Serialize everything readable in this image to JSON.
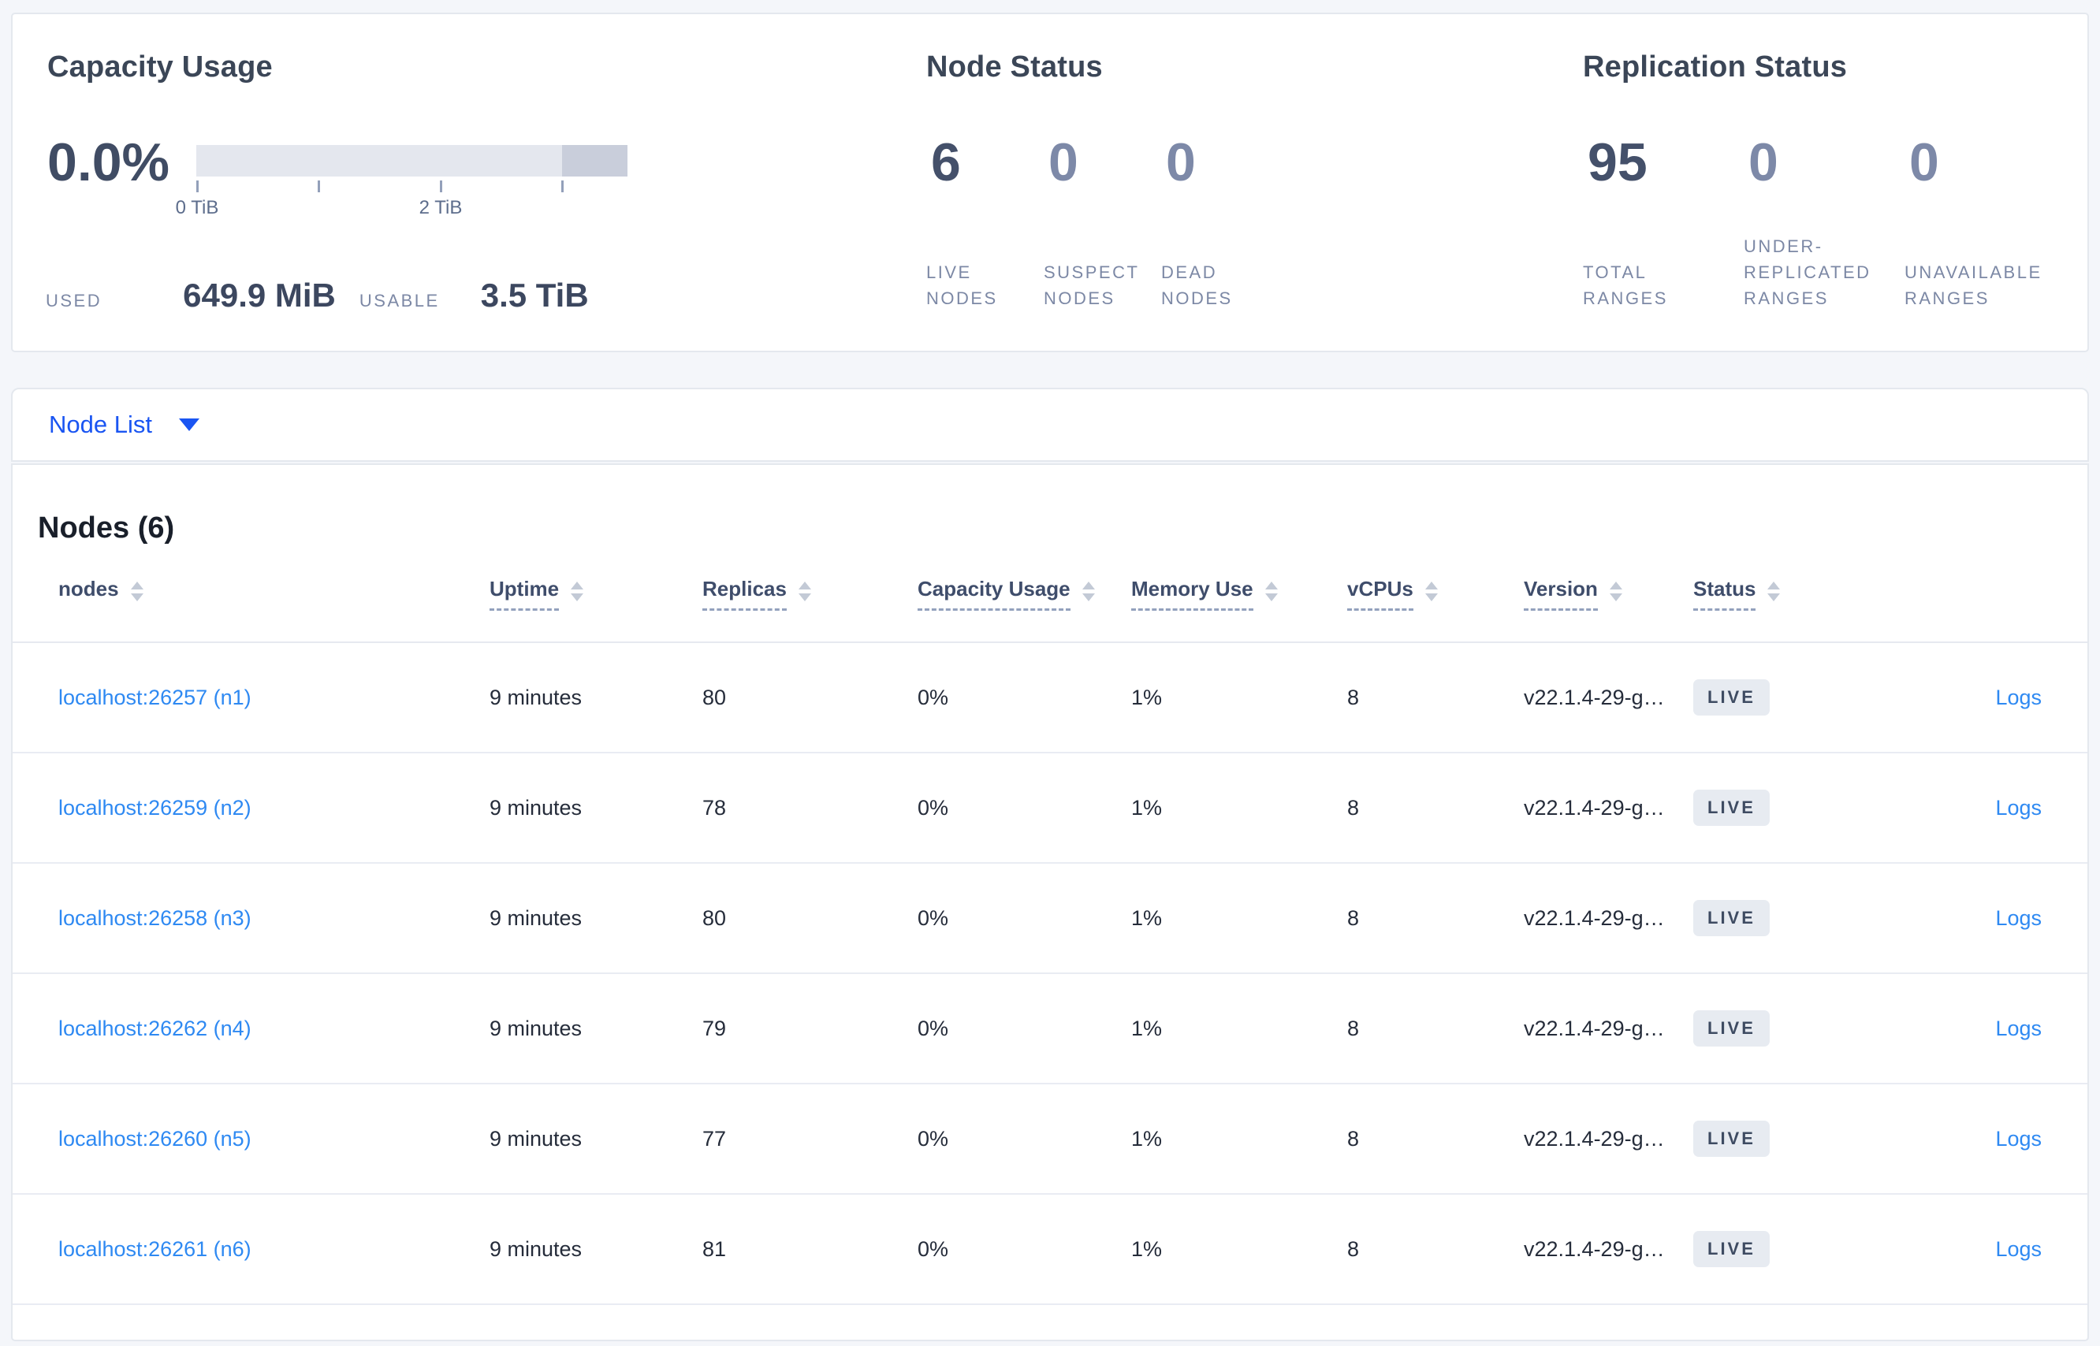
{
  "summary": {
    "capacity": {
      "title": "Capacity Usage",
      "percent": "0.0%",
      "axis_ticks": [
        "0 TiB",
        "2 TiB"
      ],
      "used_label": "USED",
      "used_value": "649.9 MiB",
      "usable_label": "USABLE",
      "usable_value": "3.5 TiB"
    },
    "node_status": {
      "title": "Node Status",
      "stats": [
        {
          "value": "6",
          "label": "LIVE NODES"
        },
        {
          "value": "0",
          "label": "SUSPECT NODES"
        },
        {
          "value": "0",
          "label": "DEAD NODES"
        }
      ]
    },
    "replication_status": {
      "title": "Replication Status",
      "stats": [
        {
          "value": "95",
          "label": "TOTAL RANGES"
        },
        {
          "value": "0",
          "label": "UNDER-REPLICATED RANGES"
        },
        {
          "value": "0",
          "label": "UNAVAILABLE RANGES"
        }
      ]
    }
  },
  "view_selector": {
    "label": "Node List"
  },
  "table": {
    "title": "Nodes (6)",
    "columns": [
      {
        "label": "nodes",
        "underline": false
      },
      {
        "label": "Uptime",
        "underline": true
      },
      {
        "label": "Replicas",
        "underline": true
      },
      {
        "label": "Capacity Usage",
        "underline": true
      },
      {
        "label": "Memory Use",
        "underline": true
      },
      {
        "label": "vCPUs",
        "underline": true
      },
      {
        "label": "Version",
        "underline": true
      },
      {
        "label": "Status",
        "underline": true
      }
    ],
    "rows": [
      {
        "address": "localhost:26257 (n1)",
        "uptime": "9 minutes",
        "replicas": "80",
        "capacity": "0%",
        "memory": "1%",
        "vcpus": "8",
        "version": "v22.1.4-29-g…",
        "status": "LIVE",
        "logs": "Logs"
      },
      {
        "address": "localhost:26259 (n2)",
        "uptime": "9 minutes",
        "replicas": "78",
        "capacity": "0%",
        "memory": "1%",
        "vcpus": "8",
        "version": "v22.1.4-29-g…",
        "status": "LIVE",
        "logs": "Logs"
      },
      {
        "address": "localhost:26258 (n3)",
        "uptime": "9 minutes",
        "replicas": "80",
        "capacity": "0%",
        "memory": "1%",
        "vcpus": "8",
        "version": "v22.1.4-29-g…",
        "status": "LIVE",
        "logs": "Logs"
      },
      {
        "address": "localhost:26262 (n4)",
        "uptime": "9 minutes",
        "replicas": "79",
        "capacity": "0%",
        "memory": "1%",
        "vcpus": "8",
        "version": "v22.1.4-29-g…",
        "status": "LIVE",
        "logs": "Logs"
      },
      {
        "address": "localhost:26260 (n5)",
        "uptime": "9 minutes",
        "replicas": "77",
        "capacity": "0%",
        "memory": "1%",
        "vcpus": "8",
        "version": "v22.1.4-29-g…",
        "status": "LIVE",
        "logs": "Logs"
      },
      {
        "address": "localhost:26261 (n6)",
        "uptime": "9 minutes",
        "replicas": "81",
        "capacity": "0%",
        "memory": "1%",
        "vcpus": "8",
        "version": "v22.1.4-29-g…",
        "status": "LIVE",
        "logs": "Logs"
      }
    ]
  },
  "icons": {
    "node_list_caret": "caret-down",
    "column_sort": "sort-arrows-up-down"
  },
  "colors": {
    "page_bg": "#f4f6fa",
    "card_border": "#e4e8ee",
    "heading_dark": "#3b4657",
    "stat_dark": "#44506a",
    "stat_light": "#7d89a8",
    "label_gray": "#7c88a5",
    "bar_light": "#e4e7ee",
    "bar_dark": "#c9cedb",
    "selector_blue": "#1a55f2",
    "link_blue": "#2e89f2",
    "badge_bg": "#e7ebf1",
    "badge_text": "#3e4b62"
  }
}
